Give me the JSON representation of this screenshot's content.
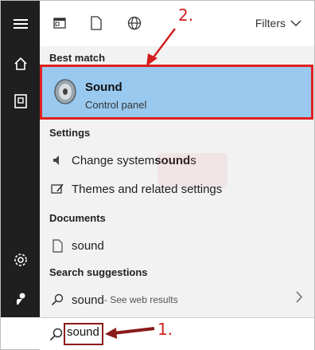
{
  "topbar": {
    "filters_label": "Filters"
  },
  "sections": {
    "best_match": "Best match",
    "settings": "Settings",
    "documents": "Documents",
    "search_suggestions": "Search suggestions"
  },
  "best_match_item": {
    "title": "Sound",
    "subtitle": "Control panel"
  },
  "settings_items": [
    {
      "prefix": "Change system ",
      "bold": "sound",
      "suffix": "s"
    },
    {
      "label": "Themes and related settings"
    }
  ],
  "documents_items": [
    {
      "label": "sound"
    }
  ],
  "suggestions": [
    {
      "label": "sound",
      "note": " - See web results"
    }
  ],
  "search": {
    "value": "sound"
  },
  "annotations": {
    "step1": "1.",
    "step2": "2."
  },
  "colors": {
    "highlight": "#99c9ef",
    "annotation": "#d41f1f",
    "rail": "#1f1f1f"
  }
}
